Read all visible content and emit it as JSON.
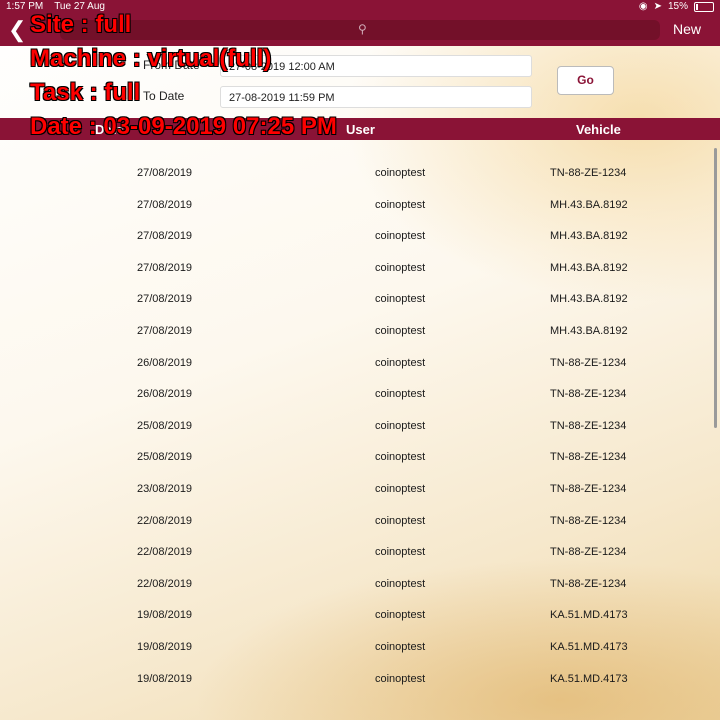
{
  "status_bar": {
    "time": "1:57 PM",
    "date": "Tue 27 Aug",
    "battery_percent": "15%",
    "battery_level": 0.15
  },
  "nav": {
    "back_icon": "chevron-left-icon",
    "search_icon": "search-icon",
    "new_label": "New"
  },
  "filter": {
    "from_label": "From Date",
    "from_value": "27-08-2019 12:00 AM",
    "to_label": "To Date",
    "to_value": "27-08-2019 11:59 PM",
    "go_label": "Go"
  },
  "table": {
    "columns": [
      "Date",
      "User",
      "Vehicle"
    ],
    "rows": [
      [
        "27/08/2019",
        "coinoptest",
        "TN-88-ZE-1234"
      ],
      [
        "27/08/2019",
        "coinoptest",
        "MH.43.BA.8192"
      ],
      [
        "27/08/2019",
        "coinoptest",
        "MH.43.BA.8192"
      ],
      [
        "27/08/2019",
        "coinoptest",
        "MH.43.BA.8192"
      ],
      [
        "27/08/2019",
        "coinoptest",
        "MH.43.BA.8192"
      ],
      [
        "27/08/2019",
        "coinoptest",
        "MH.43.BA.8192"
      ],
      [
        "26/08/2019",
        "coinoptest",
        "TN-88-ZE-1234"
      ],
      [
        "26/08/2019",
        "coinoptest",
        "TN-88-ZE-1234"
      ],
      [
        "25/08/2019",
        "coinoptest",
        "TN-88-ZE-1234"
      ],
      [
        "25/08/2019",
        "coinoptest",
        "TN-88-ZE-1234"
      ],
      [
        "23/08/2019",
        "coinoptest",
        "TN-88-ZE-1234"
      ],
      [
        "22/08/2019",
        "coinoptest",
        "TN-88-ZE-1234"
      ],
      [
        "22/08/2019",
        "coinoptest",
        "TN-88-ZE-1234"
      ],
      [
        "22/08/2019",
        "coinoptest",
        "TN-88-ZE-1234"
      ],
      [
        "19/08/2019",
        "coinoptest",
        "KA.51.MD.4173"
      ],
      [
        "19/08/2019",
        "coinoptest",
        "KA.51.MD.4173"
      ],
      [
        "19/08/2019",
        "coinoptest",
        "KA.51.MD.4173"
      ]
    ]
  },
  "overlay": {
    "site": "Site : full",
    "machine": "Machine : virtual(full)",
    "task": "Task : full",
    "date": "Date : 03-09-2019 07:25 PM"
  },
  "colors": {
    "brand": "#8a1336",
    "overlay_text": "#ff0000"
  }
}
